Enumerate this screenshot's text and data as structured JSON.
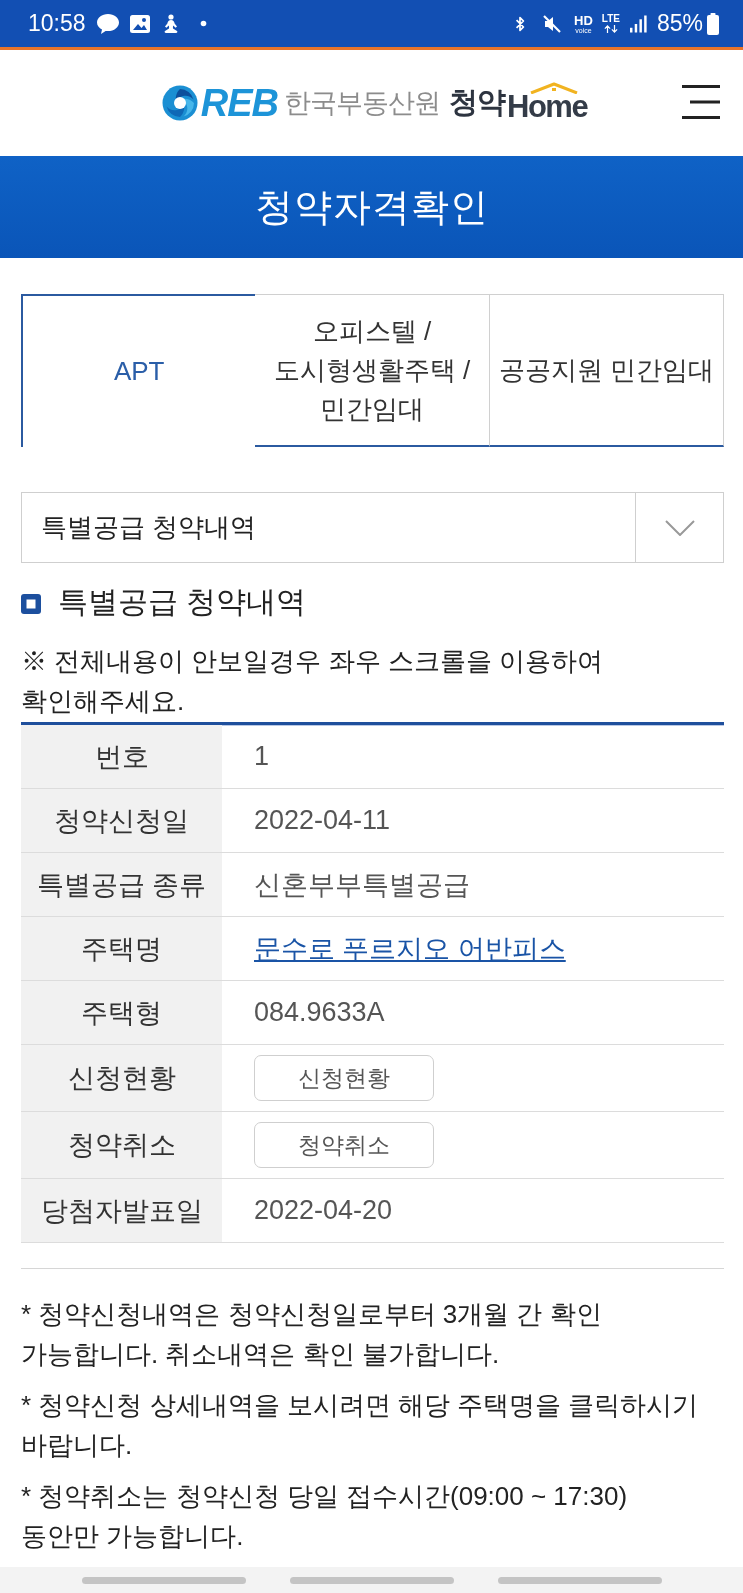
{
  "status_bar": {
    "time": "10:58",
    "hd_label": "HD",
    "voice_label": "voice",
    "lte_label": "LTE",
    "battery": "85%"
  },
  "header": {
    "logo_mark": "REB",
    "logo_org": "한국부동산원",
    "logo_service": "청약",
    "logo_home": "Home"
  },
  "page_title": "청약자격확인",
  "tabs": [
    {
      "label": "APT",
      "selected": true
    },
    {
      "label": "오피스텔 / 도시형생활주택 / 민간임대",
      "selected": false
    },
    {
      "label": "공공지원 민간임대",
      "selected": false
    }
  ],
  "dropdown": {
    "value": "특별공급 청약내역"
  },
  "section": {
    "title": "특별공급 청약내역",
    "notice": "※ 전체내용이 안보일경우 좌우 스크롤을 이용하여 확인해주세요."
  },
  "table": {
    "rows": [
      {
        "label": "번호",
        "kind": "text",
        "value": "1"
      },
      {
        "label": "청약신청일",
        "kind": "text",
        "value": "2022-04-11"
      },
      {
        "label": "특별공급 종류",
        "kind": "text",
        "value": "신혼부부특별공급"
      },
      {
        "label": "주택명",
        "kind": "link",
        "value": "문수로 푸르지오 어반피스"
      },
      {
        "label": "주택형",
        "kind": "text",
        "value": "084.9633A"
      },
      {
        "label": "신청현황",
        "kind": "button",
        "value": "신청현황"
      },
      {
        "label": "청약취소",
        "kind": "button",
        "value": "청약취소"
      },
      {
        "label": "당첨자발표일",
        "kind": "text",
        "value": "2022-04-20"
      }
    ]
  },
  "notes": [
    "* 청약신청내역은 청약신청일로부터 3개월 간 확인 가능합니다. 취소내역은 확인 불가합니다.",
    "* 청약신청 상세내역을 보시려면 해당 주택명을 클릭하시기 바랍니다.",
    "* 청약취소는 청약신청 당일 접수시간(09:00 ~ 17:30) 동안만 가능합니다."
  ]
}
